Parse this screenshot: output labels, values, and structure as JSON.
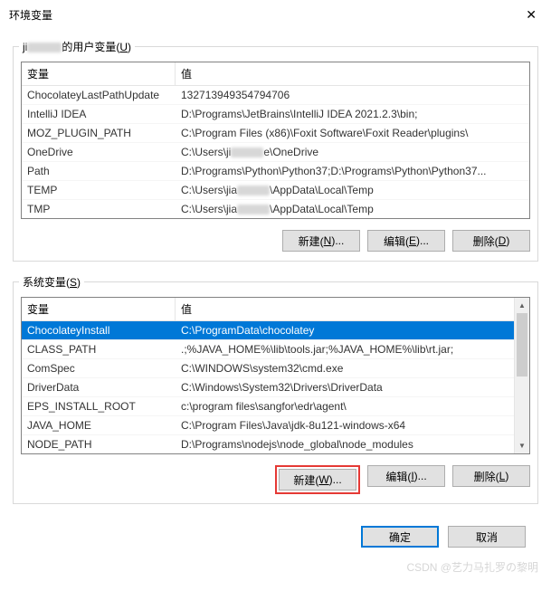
{
  "title": "环境变量",
  "user_vars": {
    "legend_prefix_obscured": true,
    "legend_suffix": "的用户变量(",
    "legend_hotkey": "U",
    "legend_close": ")",
    "headers": {
      "variable": "变量",
      "value": "值"
    },
    "rows": [
      {
        "var": "ChocolateyLastPathUpdate",
        "val": "132713949354794706"
      },
      {
        "var": "IntelliJ IDEA",
        "val": "D:\\Programs\\JetBrains\\IntelliJ IDEA 2021.2.3\\bin;"
      },
      {
        "var": "MOZ_PLUGIN_PATH",
        "val": "C:\\Program Files (x86)\\Foxit Software\\Foxit Reader\\plugins\\"
      },
      {
        "var": "OneDrive",
        "val_parts": [
          "C:\\Users\\ji",
          "e\\OneDrive"
        ],
        "obscured": true
      },
      {
        "var": "Path",
        "val": "D:\\Programs\\Python\\Python37;D:\\Programs\\Python\\Python37..."
      },
      {
        "var": "TEMP",
        "val_parts": [
          "C:\\Users\\jia",
          "\\AppData\\Local\\Temp"
        ],
        "obscured": true
      },
      {
        "var": "TMP",
        "val_parts": [
          "C:\\Users\\jia",
          "\\AppData\\Local\\Temp"
        ],
        "obscured": true
      }
    ],
    "buttons": {
      "new": {
        "text": "新建(",
        "hotkey": "N",
        "suffix": ")..."
      },
      "edit": {
        "text": "编辑(",
        "hotkey": "E",
        "suffix": ")..."
      },
      "delete": {
        "text": "删除(",
        "hotkey": "D",
        "suffix": ")"
      }
    }
  },
  "sys_vars": {
    "legend": "系统变量(",
    "legend_hotkey": "S",
    "legend_close": ")",
    "headers": {
      "variable": "变量",
      "value": "值"
    },
    "rows": [
      {
        "var": "ChocolateyInstall",
        "val": "C:\\ProgramData\\chocolatey",
        "selected": true
      },
      {
        "var": "CLASS_PATH",
        "val": ".;%JAVA_HOME%\\lib\\tools.jar;%JAVA_HOME%\\lib\\rt.jar;"
      },
      {
        "var": "ComSpec",
        "val": "C:\\WINDOWS\\system32\\cmd.exe"
      },
      {
        "var": "DriverData",
        "val": "C:\\Windows\\System32\\Drivers\\DriverData"
      },
      {
        "var": "EPS_INSTALL_ROOT",
        "val": "c:\\program files\\sangfor\\edr\\agent\\"
      },
      {
        "var": "JAVA_HOME",
        "val": "C:\\Program Files\\Java\\jdk-8u121-windows-x64"
      },
      {
        "var": "NODE_PATH",
        "val": "D:\\Programs\\nodejs\\node_global\\node_modules"
      }
    ],
    "buttons": {
      "new": {
        "text": "新建(",
        "hotkey": "W",
        "suffix": ")..."
      },
      "edit": {
        "text": "编辑(",
        "hotkey": "I",
        "suffix": ")..."
      },
      "delete": {
        "text": "删除(",
        "hotkey": "L",
        "suffix": ")"
      }
    }
  },
  "dialog_buttons": {
    "ok": "确定",
    "cancel": "取消"
  },
  "watermark": "CSDN @艺力马扎罗の黎明"
}
